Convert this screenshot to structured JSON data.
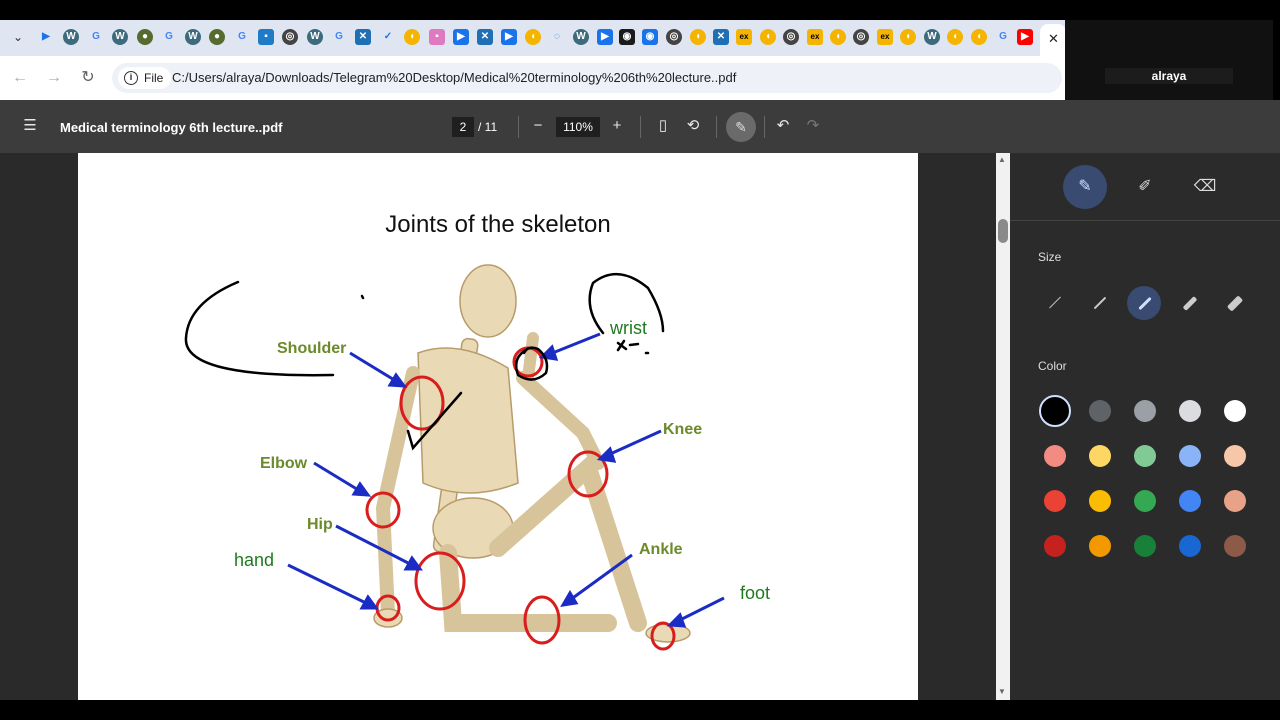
{
  "browser": {
    "address": {
      "scheme_label": "File",
      "url": "C:/Users/alraya/Downloads/Telegram%20Desktop/Medical%20terminology%206th%20lecture..pdf"
    },
    "tab_close": "✕"
  },
  "webcam": {
    "name": "alraya"
  },
  "pdf_toolbar": {
    "title": "Medical terminology 6th lecture..pdf",
    "current_page": "2",
    "total_pages": "/ 11",
    "zoom": "110%"
  },
  "slide": {
    "title": "Joints of the skeleton",
    "labels": {
      "shoulder": "Shoulder",
      "wrist": "wrist",
      "knee": "Knee",
      "elbow": "Elbow",
      "hip": "Hip",
      "hand": "hand",
      "ankle": "Ankle",
      "foot": "foot"
    }
  },
  "side_panel": {
    "size_heading": "Size",
    "color_heading": "Color",
    "colors": [
      "#000000",
      "#5f6368",
      "#9aa0a6",
      "#dadce0",
      "#ffffff",
      "#f28b82",
      "#fdd663",
      "#81c995",
      "#8ab4f8",
      "#f6c7a8",
      "#ea4335",
      "#fbbc04",
      "#34a853",
      "#4285f4",
      "#e8a288",
      "#c5221f",
      "#f29900",
      "#188038",
      "#1967d2",
      "#8d5a48"
    ]
  }
}
